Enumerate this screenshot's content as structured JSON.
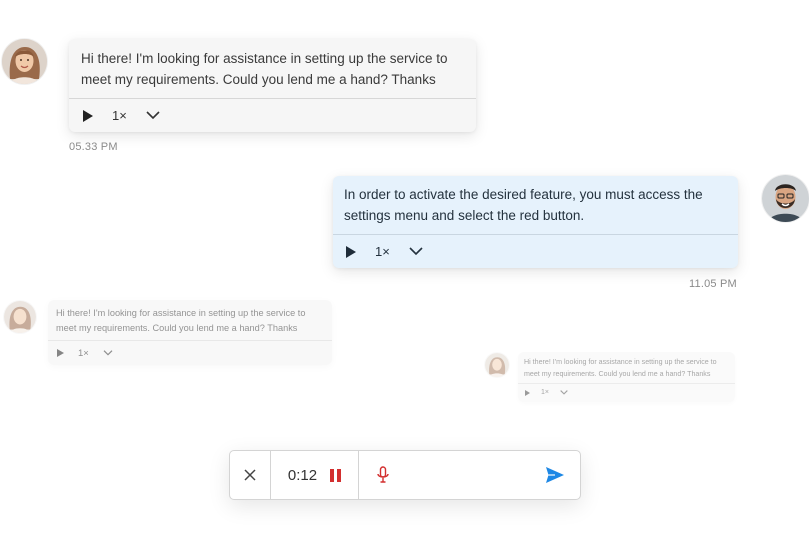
{
  "messages": [
    {
      "text": "Hi there! I'm looking for assistance in setting up the service to meet my requirements. Could you lend me a hand? Thanks",
      "speed": "1×",
      "time": "05.33 PM",
      "avatar": "woman-avatar"
    },
    {
      "text": "In order to activate the desired feature, you must access the settings menu and select the red button.",
      "speed": "1×",
      "time": "11.05 PM",
      "avatar": "man-avatar"
    },
    {
      "text": "Hi there! I'm looking for assistance in setting up the service to meet my requirements. Could you lend me a hand? Thanks",
      "speed": "1×"
    },
    {
      "text": "Hi there! I'm looking for assistance in setting up the service to meet my requirements. Could you lend me a hand? Thanks",
      "speed": "1×"
    }
  ],
  "composer": {
    "timer": "0:12",
    "icons": [
      "close-icon",
      "pause-icon",
      "microphone-icon",
      "send-icon"
    ]
  },
  "colors": {
    "incoming_bubble": "#f6f6f6",
    "outgoing_bubble": "#e6f2fc",
    "pause_red": "#d32f2f",
    "send_blue": "#1e88e5"
  }
}
